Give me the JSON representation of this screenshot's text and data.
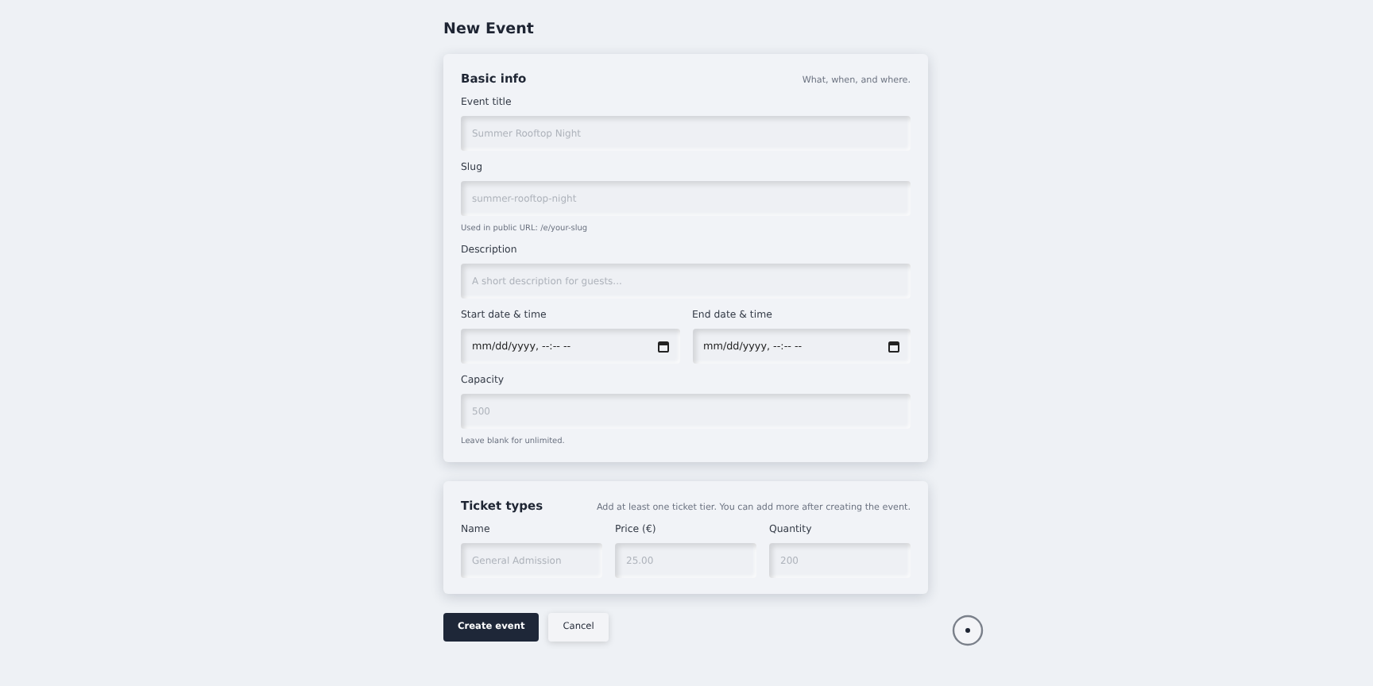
{
  "page_title": "New Event",
  "sections": [
    {
      "title": "Basic info",
      "subtitle": "What, when, and where.",
      "rows": [
        {
          "fields": [
            {
              "kind": "text",
              "label": "Event title",
              "placeholder": "Summer Rooftop Night"
            }
          ]
        },
        {
          "fields": [
            {
              "kind": "text",
              "label": "Slug",
              "placeholder": "summer-rooftop-night",
              "hint": "Used in public URL: /e/your-slug"
            }
          ]
        },
        {
          "fields": [
            {
              "kind": "text",
              "label": "Description",
              "placeholder": "A short description for guests..."
            }
          ]
        },
        {
          "fields": [
            {
              "kind": "datetime",
              "label": "Start date & time",
              "value": "mm/dd/yyyy, --:-- --"
            },
            {
              "kind": "datetime",
              "label": "End date & time",
              "value": "mm/dd/yyyy, --:-- --"
            }
          ]
        },
        {
          "fields": [
            {
              "kind": "text",
              "label": "Capacity",
              "placeholder": "500",
              "hint": "Leave blank for unlimited."
            }
          ]
        }
      ]
    },
    {
      "title": "Ticket types",
      "subtitle": "Add at least one ticket tier. You can add more after creating the event.",
      "rows": [
        {
          "fields": [
            {
              "kind": "text",
              "label": "Name",
              "placeholder": "General Admission"
            },
            {
              "kind": "text",
              "label": "Price (€)",
              "placeholder": "25.00"
            },
            {
              "kind": "text",
              "label": "Quantity",
              "placeholder": "200"
            }
          ]
        }
      ]
    }
  ],
  "buttons": [
    {
      "kind": "primary",
      "label": "Create event"
    },
    {
      "kind": "secondary",
      "label": "Cancel"
    }
  ]
}
